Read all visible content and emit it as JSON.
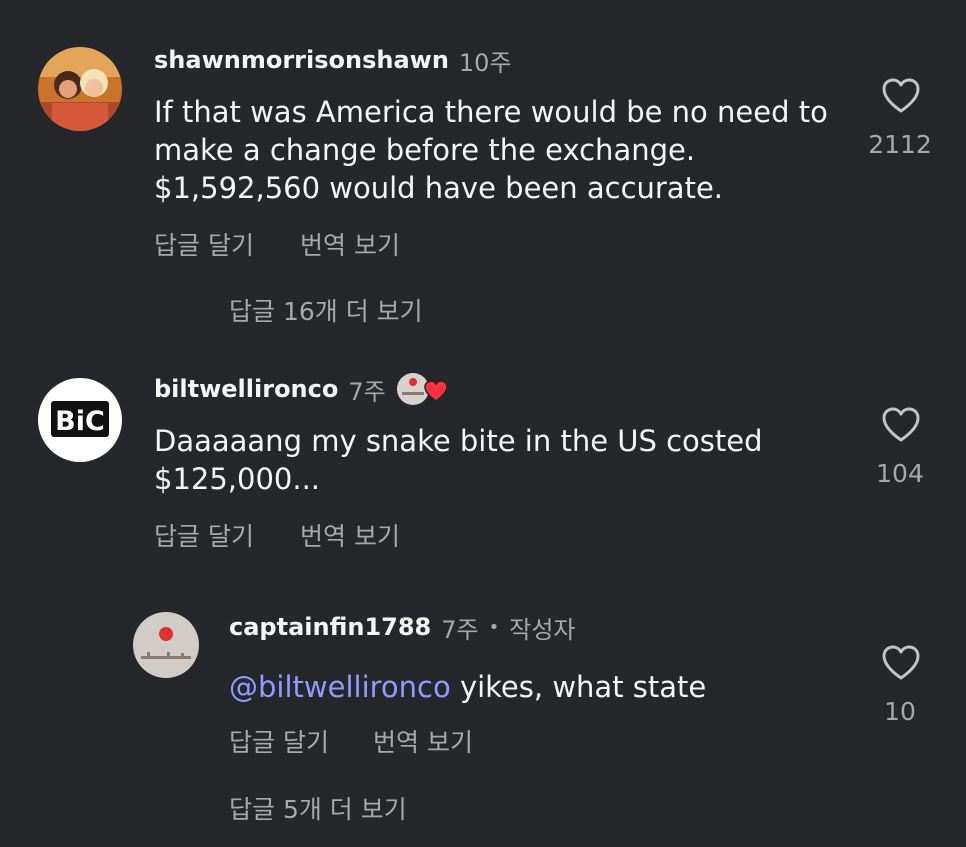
{
  "comments": [
    {
      "username": "shawnmorrisonshawn",
      "time": "10주",
      "lines": [
        "If that was America there would be no need to",
        "make a change before the exchange.",
        "$1,592,560 would have been accurate."
      ],
      "likes": "2112",
      "reply_label": "답글 달기",
      "translate_label": "번역 보기",
      "more_replies": "답글 16개 더 보기"
    },
    {
      "username": "biltwellironco",
      "time": "7주",
      "avatar_text": "BiC",
      "lines": [
        "Daaaaang my snake bite in the US costed",
        "$125,000..."
      ],
      "likes": "104",
      "reply_label": "답글 달기",
      "translate_label": "번역 보기"
    },
    {
      "username": "captainfin1788",
      "time": "7주",
      "author_badge": "작성자",
      "mention": "@biltwellironco",
      "text": " yikes, what state",
      "likes": "10",
      "reply_label": "답글 달기",
      "translate_label": "번역 보기",
      "more_replies": "답글 5개 더 보기"
    }
  ],
  "colors": {
    "background": "#25272b",
    "mention": "#8f9cff",
    "heart_badge": "#ff3040"
  }
}
